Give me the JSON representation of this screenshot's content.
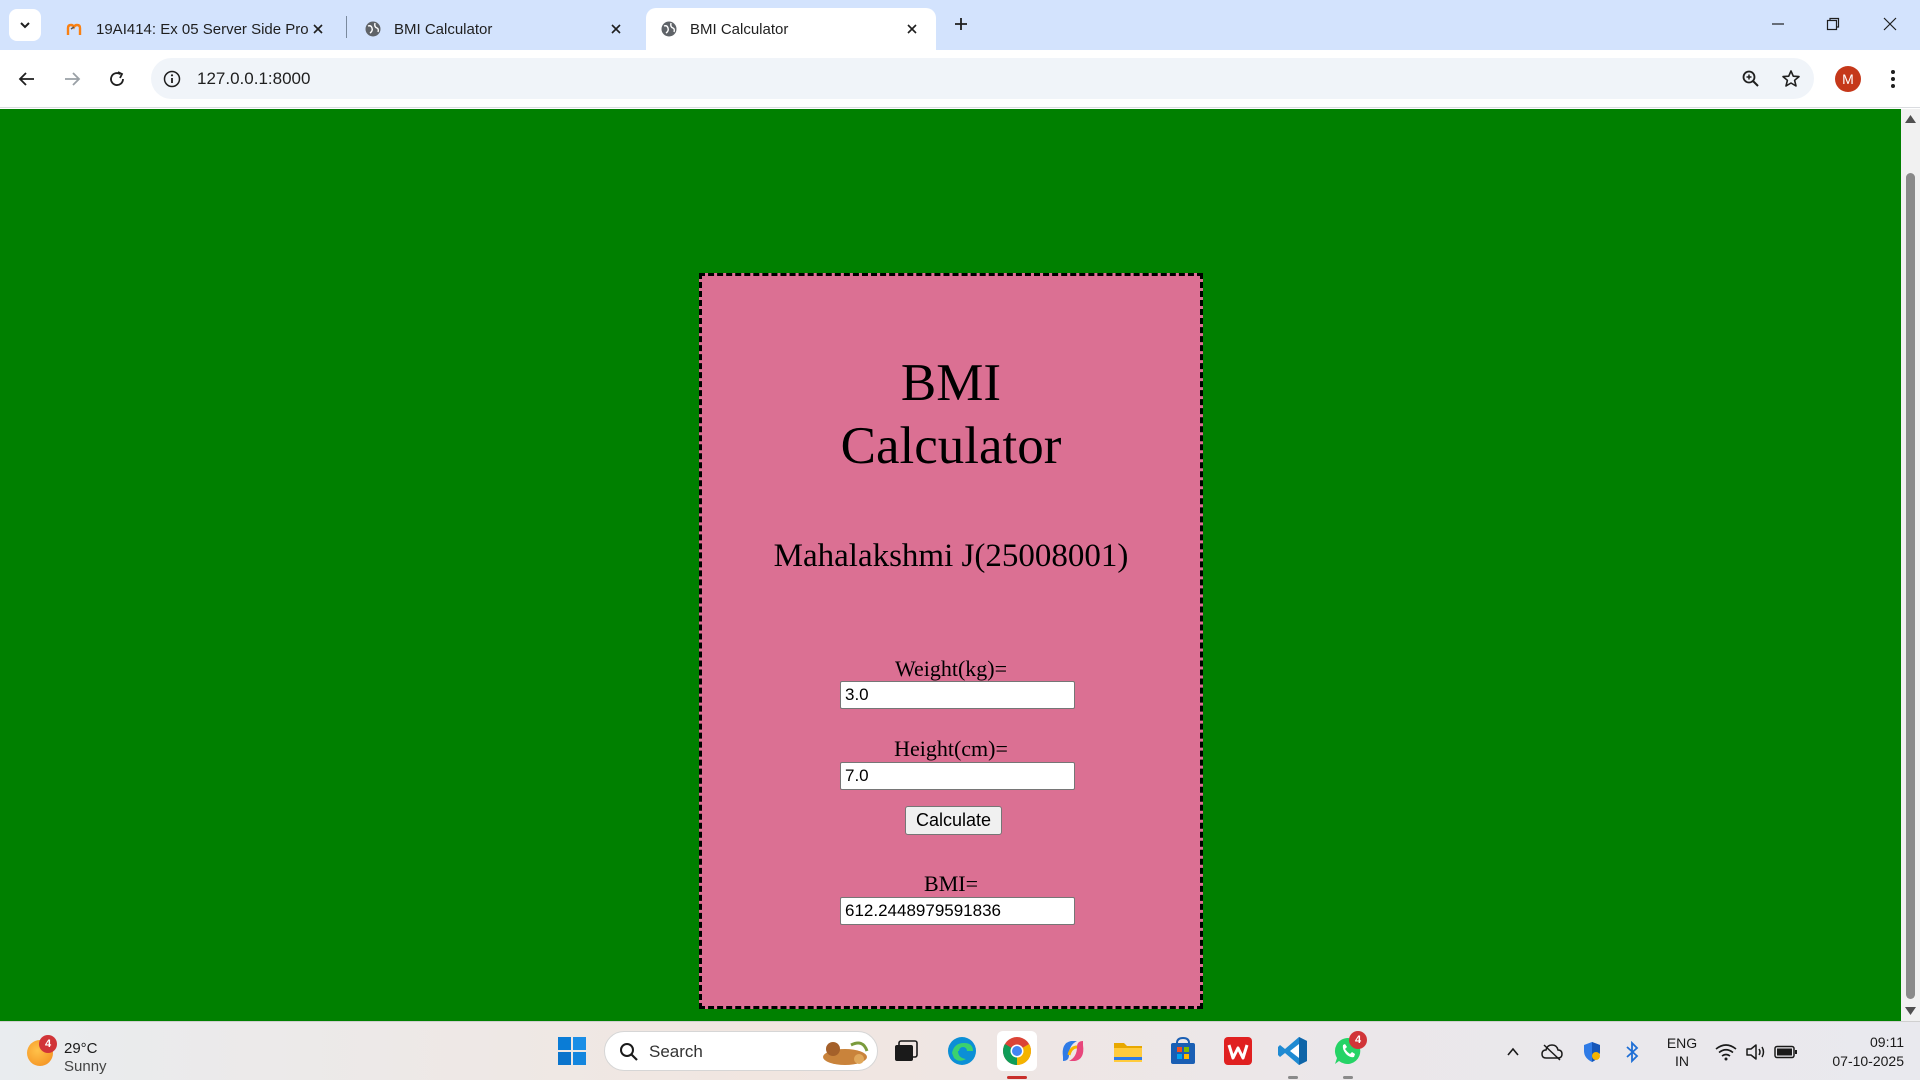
{
  "browser": {
    "tabs": [
      {
        "title": "19AI414: Ex 05 Server Side Proc",
        "favicon": "moodle-icon",
        "active": false
      },
      {
        "title": "BMI Calculator",
        "favicon": "globe-icon",
        "active": false
      },
      {
        "title": "BMI Calculator",
        "favicon": "globe-icon",
        "active": true
      }
    ],
    "url": "127.0.0.1:8000",
    "profile_initial": "M",
    "profile_color": "#c5381a"
  },
  "page": {
    "background_color": "#008000",
    "card_color": "#db7093",
    "heading_line1": "BMI",
    "heading_line2": "Calculator",
    "author": "Mahalakshmi J(25008001)",
    "weight_label": "Weight(kg)=",
    "weight_value": "3.0",
    "height_label": "Height(cm)=",
    "height_value": "7.0",
    "calculate_label": "Calculate",
    "bmi_label": "BMI=",
    "bmi_value": "612.2448979591836"
  },
  "taskbar": {
    "weather_temp": "29°C",
    "weather_condition": "Sunny",
    "weather_badge": "4",
    "search_label": "Search",
    "whatsapp_badge": "4",
    "lang_line1": "ENG",
    "lang_line2": "IN",
    "time": "09:11",
    "date": "07-10-2025",
    "apps": [
      "start-icon",
      "task-view-icon",
      "edge-icon",
      "chrome-icon",
      "copilot-icon",
      "file-explorer-icon",
      "store-icon",
      "wps-office-icon",
      "vscode-icon",
      "whatsapp-icon"
    ]
  }
}
